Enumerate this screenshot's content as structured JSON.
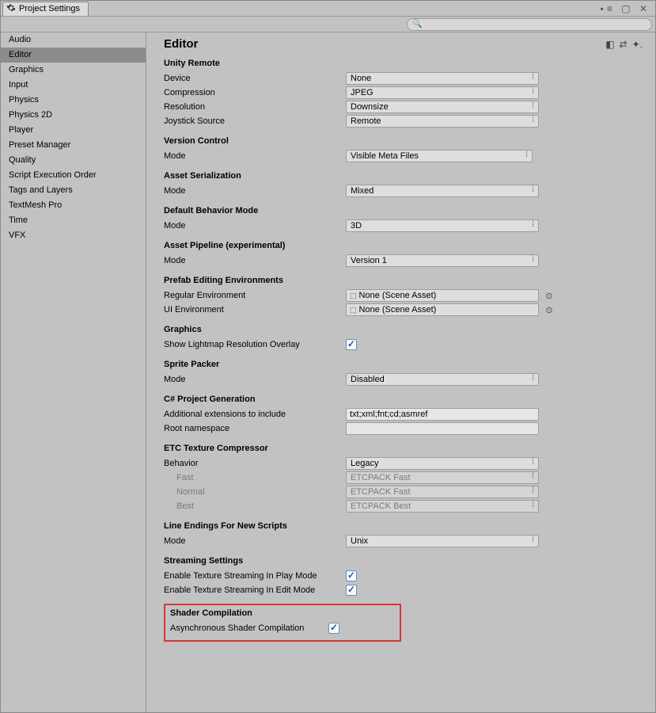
{
  "window": {
    "title": "Project Settings"
  },
  "search": {
    "placeholder": ""
  },
  "sidebar": {
    "items": [
      "Audio",
      "Editor",
      "Graphics",
      "Input",
      "Physics",
      "Physics 2D",
      "Player",
      "Preset Manager",
      "Quality",
      "Script Execution Order",
      "Tags and Layers",
      "TextMesh Pro",
      "Time",
      "VFX"
    ],
    "selectedIndex": 1
  },
  "page": {
    "title": "Editor",
    "sections": {
      "unityRemote": {
        "title": "Unity Remote",
        "device": {
          "label": "Device",
          "value": "None"
        },
        "compression": {
          "label": "Compression",
          "value": "JPEG"
        },
        "resolution": {
          "label": "Resolution",
          "value": "Downsize"
        },
        "joystick": {
          "label": "Joystick Source",
          "value": "Remote"
        }
      },
      "versionControl": {
        "title": "Version Control",
        "mode": {
          "label": "Mode",
          "value": "Visible Meta Files"
        }
      },
      "assetSerialization": {
        "title": "Asset Serialization",
        "mode": {
          "label": "Mode",
          "value": "Mixed"
        }
      },
      "defaultBehavior": {
        "title": "Default Behavior Mode",
        "mode": {
          "label": "Mode",
          "value": "3D"
        }
      },
      "assetPipeline": {
        "title": "Asset Pipeline (experimental)",
        "mode": {
          "label": "Mode",
          "value": "Version 1"
        }
      },
      "prefab": {
        "title": "Prefab Editing Environments",
        "regular": {
          "label": "Regular Environment",
          "value": "None (Scene Asset)"
        },
        "ui": {
          "label": "UI Environment",
          "value": "None (Scene Asset)"
        }
      },
      "graphics": {
        "title": "Graphics",
        "lightmap": {
          "label": "Show Lightmap Resolution Overlay",
          "checked": true
        }
      },
      "spritePacker": {
        "title": "Sprite Packer",
        "mode": {
          "label": "Mode",
          "value": "Disabled"
        }
      },
      "csharp": {
        "title": "C# Project Generation",
        "extensions": {
          "label": "Additional extensions to include",
          "value": "txt;xml;fnt;cd;asmref"
        },
        "rootns": {
          "label": "Root namespace",
          "value": ""
        }
      },
      "etc": {
        "title": "ETC Texture Compressor",
        "behavior": {
          "label": "Behavior",
          "value": "Legacy"
        },
        "fast": {
          "label": "Fast",
          "value": "ETCPACK Fast"
        },
        "normal": {
          "label": "Normal",
          "value": "ETCPACK Fast"
        },
        "best": {
          "label": "Best",
          "value": "ETCPACK Best"
        }
      },
      "lineEndings": {
        "title": "Line Endings For New Scripts",
        "mode": {
          "label": "Mode",
          "value": "Unix"
        }
      },
      "streaming": {
        "title": "Streaming Settings",
        "play": {
          "label": "Enable Texture Streaming In Play Mode",
          "checked": true
        },
        "edit": {
          "label": "Enable Texture Streaming In Edit Mode",
          "checked": true
        }
      },
      "shader": {
        "title": "Shader Compilation",
        "async": {
          "label": "Asynchronous Shader Compilation",
          "checked": true
        }
      }
    }
  }
}
